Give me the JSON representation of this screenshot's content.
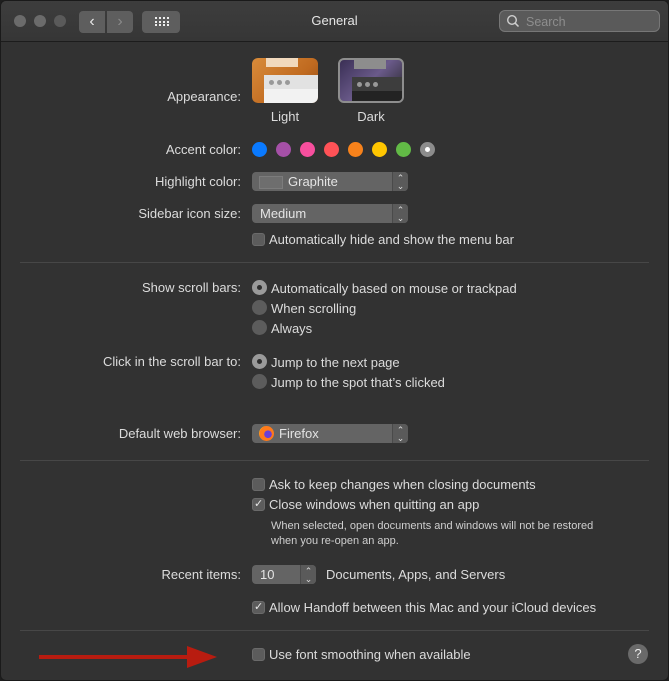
{
  "window": {
    "title": "General",
    "search_placeholder": "Search",
    "back_icon": "‹",
    "forward_icon": "›"
  },
  "appearance": {
    "label": "Appearance:",
    "options": [
      {
        "name": "Light",
        "selected": false
      },
      {
        "name": "Dark",
        "selected": true
      }
    ]
  },
  "accent_color": {
    "label": "Accent color:",
    "colors": [
      {
        "name": "Blue",
        "hex": "#0a7aff"
      },
      {
        "name": "Purple",
        "hex": "#a550a7"
      },
      {
        "name": "Pink",
        "hex": "#f74f9e"
      },
      {
        "name": "Red",
        "hex": "#ff5257"
      },
      {
        "name": "Orange",
        "hex": "#f7821b"
      },
      {
        "name": "Yellow",
        "hex": "#ffc600"
      },
      {
        "name": "Green",
        "hex": "#62ba46"
      },
      {
        "name": "Graphite",
        "hex": "#8c8c8c",
        "selected": true
      }
    ]
  },
  "highlight_color": {
    "label": "Highlight color:",
    "value": "Graphite"
  },
  "sidebar_icon_size": {
    "label": "Sidebar icon size:",
    "value": "Medium"
  },
  "auto_hide_menu_bar": {
    "label": "Automatically hide and show the menu bar",
    "checked": false
  },
  "show_scroll_bars": {
    "label": "Show scroll bars:",
    "options": [
      {
        "label": "Automatically based on mouse or trackpad",
        "selected": true
      },
      {
        "label": "When scrolling",
        "selected": false
      },
      {
        "label": "Always",
        "selected": false
      }
    ]
  },
  "click_scroll_bar": {
    "label": "Click in the scroll bar to:",
    "options": [
      {
        "label": "Jump to the next page",
        "selected": true
      },
      {
        "label": "Jump to the spot that’s clicked",
        "selected": false
      }
    ]
  },
  "default_browser": {
    "label": "Default web browser:",
    "value": "Firefox"
  },
  "ask_keep_changes": {
    "label": "Ask to keep changes when closing documents",
    "checked": false
  },
  "close_windows": {
    "label": "Close windows when quitting an app",
    "checked": true,
    "note_line1": "When selected, open documents and windows will not be restored",
    "note_line2": "when you re-open an app."
  },
  "recent_items": {
    "label": "Recent items:",
    "value": "10",
    "suffix": "Documents, Apps, and Servers"
  },
  "handoff": {
    "label": "Allow Handoff between this Mac and your iCloud devices",
    "checked": true
  },
  "font_smoothing": {
    "label": "Use font smoothing when available",
    "checked": false
  },
  "help_label": "?",
  "annotation": {
    "arrow_color": "#b81c10"
  }
}
